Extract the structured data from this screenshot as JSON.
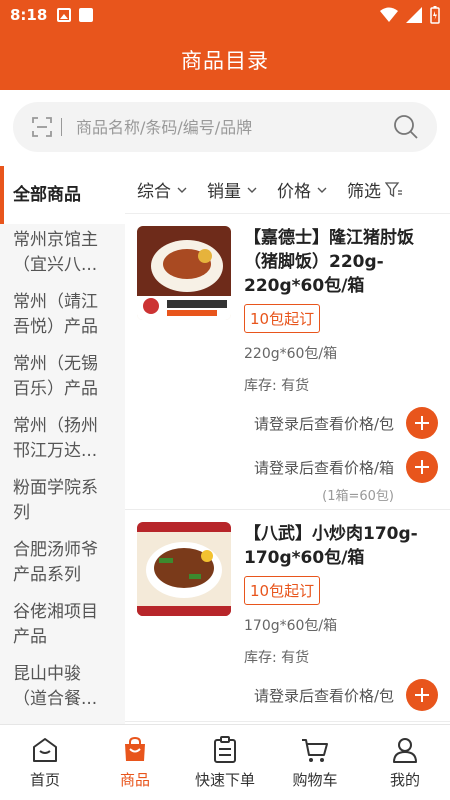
{
  "status_bar": {
    "time": "8:18"
  },
  "header": {
    "title": "商品目录"
  },
  "search": {
    "placeholder": "商品名称/条码/编号/品牌"
  },
  "sidebar": {
    "items": [
      {
        "label": "全部商品",
        "active": true
      },
      {
        "label": "常州京馆主（宜兴八..."
      },
      {
        "label": "常州（靖江吾悦）产品"
      },
      {
        "label": "常州（无锡百乐）产品"
      },
      {
        "label": "常州（扬州邗江万达..."
      },
      {
        "label": "粉面学院系列"
      },
      {
        "label": "合肥汤师爷产品系列"
      },
      {
        "label": "谷佬湘项目产品"
      },
      {
        "label": "昆山中骏（道合餐..."
      }
    ]
  },
  "filters": {
    "comprehensive": "综合",
    "sales": "销量",
    "price": "价格",
    "filter": "筛选"
  },
  "products": [
    {
      "name": "【嘉德士】隆江猪肘饭（猪脚饭）220g-220g*60包/箱",
      "min_order": "10包起订",
      "spec": "220g*60包/箱",
      "stock": "库存: 有货",
      "price_unit": "请登录后查看价格/包",
      "price_box": "请登录后查看价格/箱",
      "box_note": "(1箱=60包)"
    },
    {
      "name": "【八武】小炒肉170g-170g*60包/箱",
      "min_order": "10包起订",
      "spec": "170g*60包/箱",
      "stock": "库存: 有货",
      "price_unit": "请登录后查看价格/包"
    }
  ],
  "tabbar": {
    "home": "首页",
    "goods": "商品",
    "quick_order": "快速下单",
    "cart": "购物车",
    "mine": "我的"
  },
  "colors": {
    "accent": "#e8551c"
  }
}
